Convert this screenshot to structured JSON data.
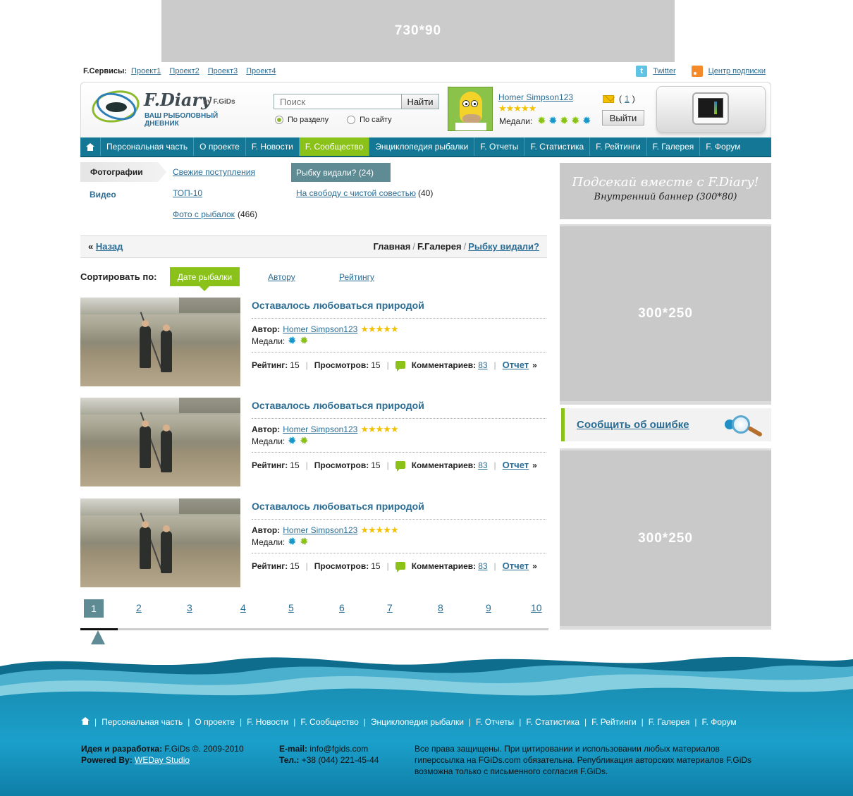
{
  "banners": {
    "top": "730*90",
    "side_title": "Подсекай вместе с F.Diary!",
    "side_sub": "Внутренний баннер (300*80)",
    "side_box1": "300*250",
    "side_box2": "300*250"
  },
  "services": {
    "label": "F.Сервисы:",
    "links": [
      "Проект1",
      "Проект2",
      "Проект3",
      "Проект4"
    ],
    "twitter": "Twitter",
    "subscribe": "Центр подписки"
  },
  "logo": {
    "title": "F.Diary",
    "by": "by F.GiDs",
    "subtitle": "ВАШ РЫБОЛОВНЫЙ ДНЕВНИК"
  },
  "search": {
    "placeholder": "Поиск",
    "button": "Найти",
    "option_section": "По разделу",
    "option_site": "По сайту"
  },
  "user": {
    "name": "Homer Simpson123",
    "stars": "★★★★★",
    "medals_label": "Медали:",
    "mail_prefix": "(",
    "mail_count": "1",
    "mail_suffix": ")",
    "logout": "Выйти"
  },
  "nav": {
    "items": [
      "Персональная часть",
      "О проекте",
      "F. Новости",
      "F. Сообщество",
      "Энциклопедия рыбалки",
      "F. Отчеты",
      "F. Статистика",
      "F. Рейтинги",
      "F. Галерея",
      "F. Форум"
    ],
    "active_index": 3
  },
  "gallery": {
    "photos_tab": "Фотографии",
    "video_tab": "Видео",
    "col1": [
      "Свежие поступления",
      "ТОП-10",
      "Фото с рыбалок"
    ],
    "col1_count3": "(466)",
    "active": "Рыбку видали? (24)",
    "col2_link": "На свободу с чистой совестью",
    "col2_count": "(40)"
  },
  "breadcrumb": {
    "back_arrow": "«",
    "back": "Назад",
    "home": "Главная",
    "gallery": "F.Галерея",
    "current": "Рыбку видали?"
  },
  "sort": {
    "label": "Сортировать по:",
    "active": "Дате рыбалки",
    "author": "Автору",
    "rating": "Рейтингу"
  },
  "items": [
    {
      "title": "Оставалось любоваться природой",
      "author_label": "Автор:",
      "author": "Homer Simpson123",
      "stars": "★★★★★",
      "medals_label": "Медали:",
      "rating_label": "Рейтинг:",
      "rating": "15",
      "views_label": "Просмотров:",
      "views": "15",
      "comments_label": "Комментариев:",
      "comments": "83",
      "report": "Отчет",
      "report_arrow": "»"
    },
    {
      "title": "Оставалось любоваться природой",
      "author_label": "Автор:",
      "author": "Homer Simpson123",
      "stars": "★★★★★",
      "medals_label": "Медали:",
      "rating_label": "Рейтинг:",
      "rating": "15",
      "views_label": "Просмотров:",
      "views": "15",
      "comments_label": "Комментариев:",
      "comments": "83",
      "report": "Отчет",
      "report_arrow": "»"
    },
    {
      "title": "Оставалось любоваться природой",
      "author_label": "Автор:",
      "author": "Homer Simpson123",
      "stars": "★★★★★",
      "medals_label": "Медали:",
      "rating_label": "Рейтинг:",
      "rating": "15",
      "views_label": "Просмотров:",
      "views": "15",
      "comments_label": "Комментариев:",
      "comments": "83",
      "report": "Отчет",
      "report_arrow": "»"
    }
  ],
  "pager": {
    "pages": [
      "1",
      "2",
      "3",
      "4",
      "5",
      "6",
      "7",
      "8",
      "9",
      "10"
    ],
    "current": "1"
  },
  "error_report": "Сообщить об ошибке",
  "footer": {
    "nav": [
      "Персональная часть",
      "О проекте",
      "F. Новости",
      "F. Сообщество",
      "Энциклопедия рыбалки",
      "F. Отчеты",
      "F. Статистика",
      "F. Рейтинги",
      "F. Галерея",
      "F. Форум"
    ],
    "idea_label": "Идея и разработка:",
    "idea_value": "F.GiDs ©. 2009-2010",
    "powered_label": "Powered By:",
    "powered_value": "WEDay Studio",
    "email_label": "E-mail:",
    "email_value": "info@fgids.com",
    "phone_label": "Тел.:",
    "phone_value": "+38 (044) 221-45-44",
    "rights": "Все права защищены. При цитировании и использовании любых материалов гиперссылка на FGiDs.com обязательна. Републикация авторских материалов F.GiDs возможна только с письменного согласия F.GiDs."
  },
  "colors": {
    "nav_bg": "#147795",
    "accent_green": "#8bc21a",
    "link_blue": "#2b6d94",
    "muted_teal": "#5f8b94",
    "placeholder_gray": "#c9c9c9"
  },
  "icons": [
    "home-icon",
    "twitter-icon",
    "rss-icon",
    "mail-icon",
    "comment-icon",
    "medal-icon",
    "star-icon",
    "bug-magnifier-icon"
  ]
}
